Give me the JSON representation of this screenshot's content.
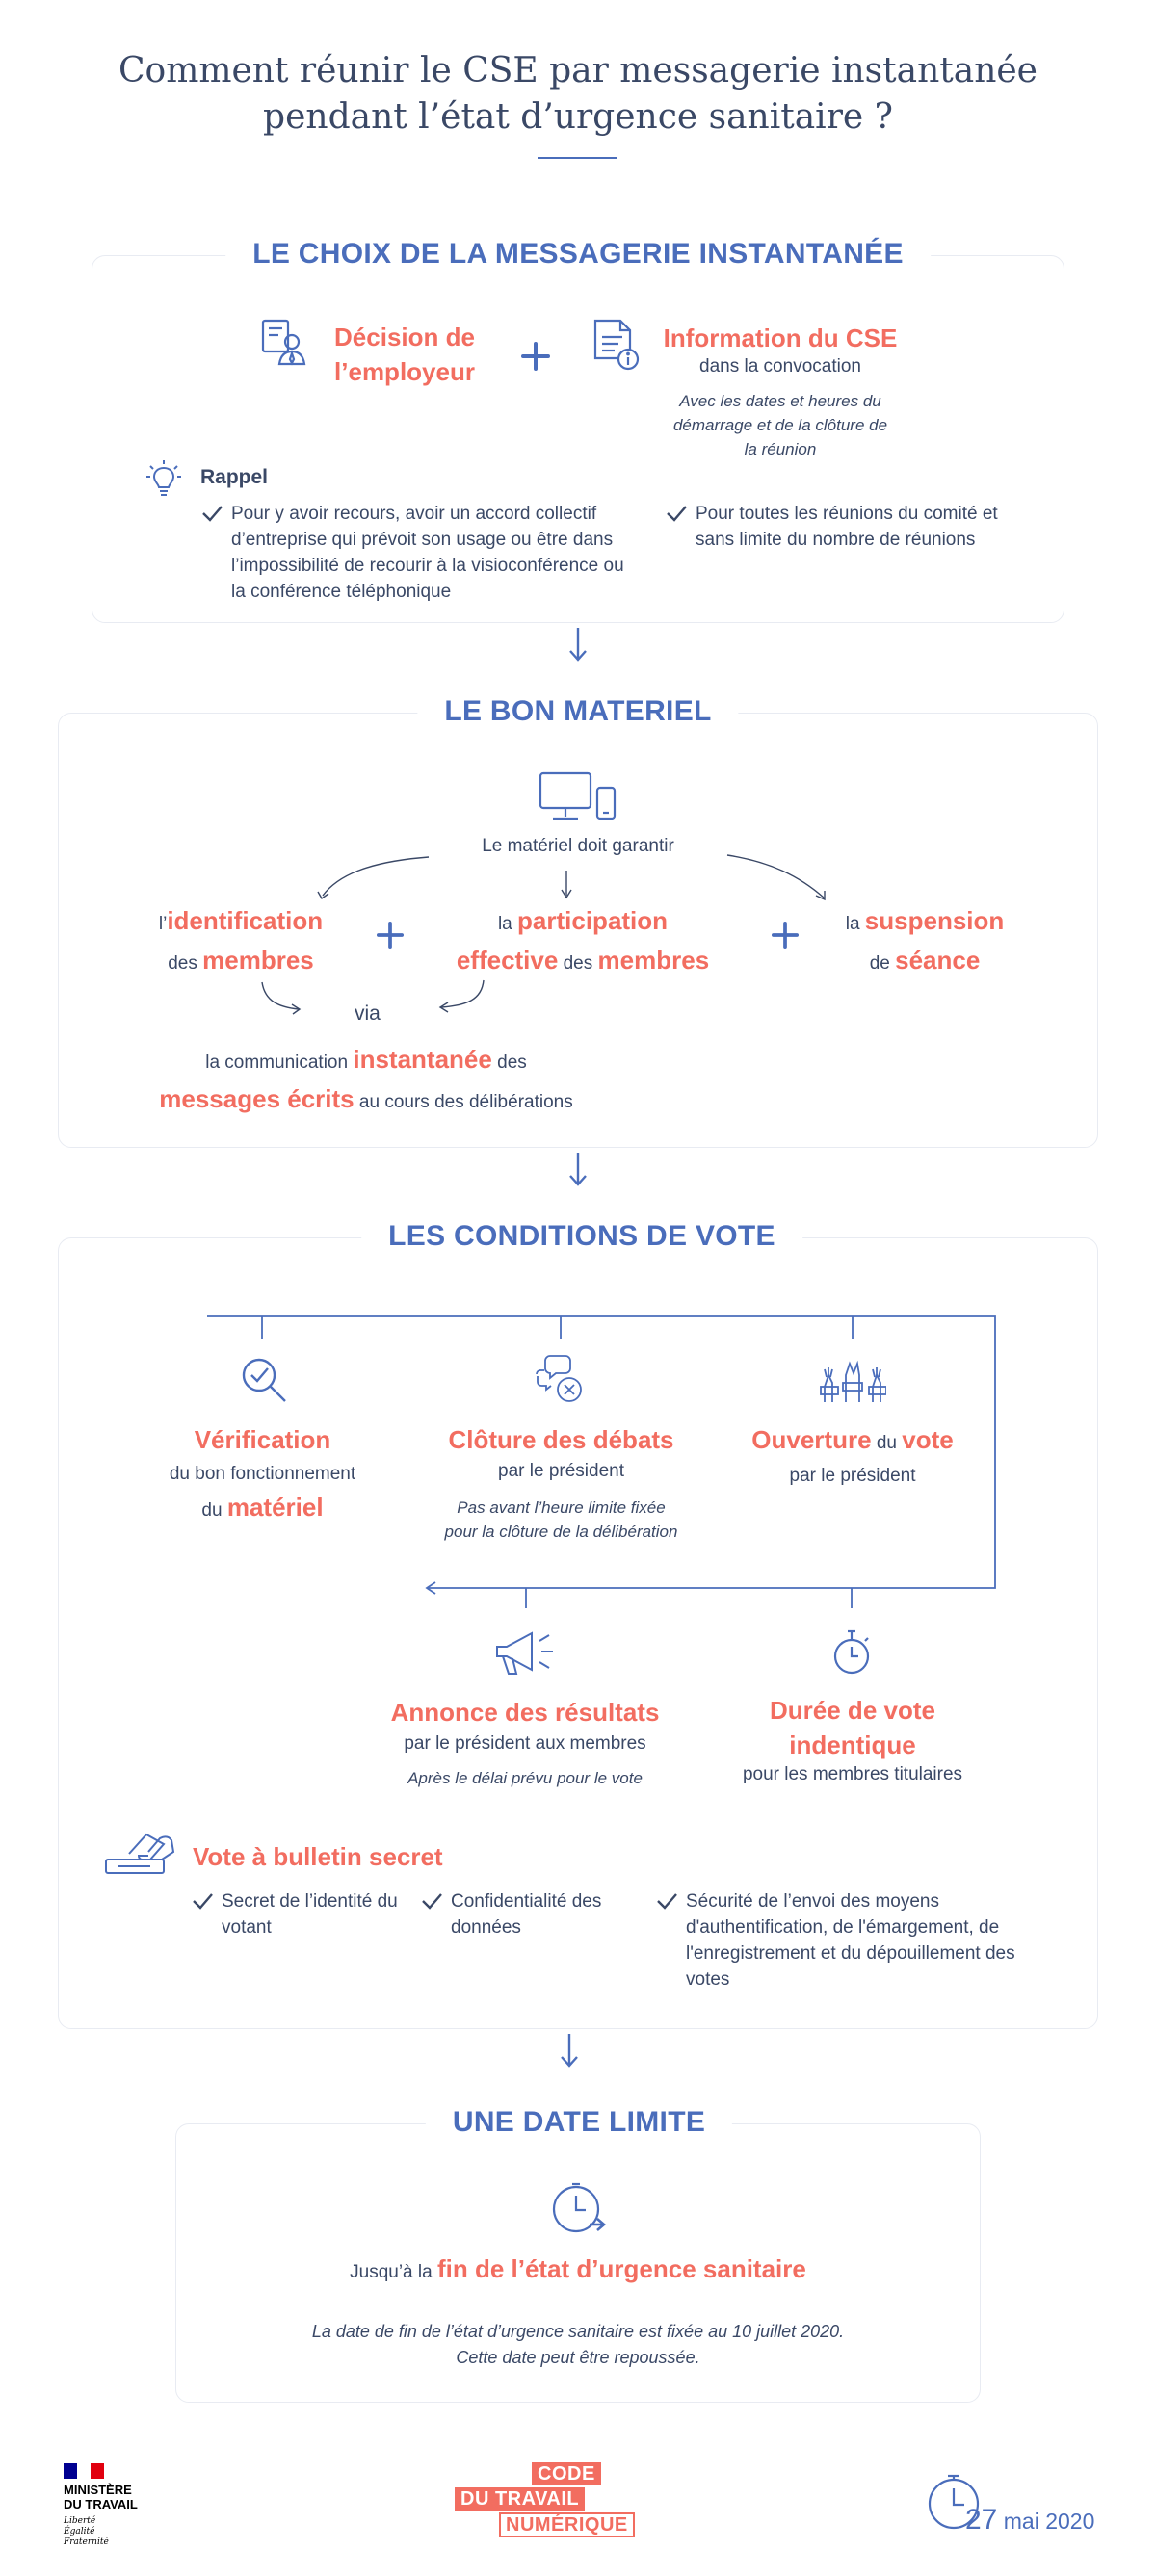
{
  "header": {
    "title_line1": "Comment réunir le CSE par messagerie instantanée",
    "title_line2": "pendant l’état d’urgence sanitaire ?"
  },
  "section1": {
    "title": "LE CHOIX DE LA MESSAGERIE INSTANTANÉE",
    "employer_line1": "Décision de",
    "employer_line2": "l’employeur",
    "info_title": "Information du CSE",
    "info_sub": "dans la convocation",
    "info_note_line1": "Avec les dates et heures du",
    "info_note_line2": "démarrage et de la clôture de",
    "info_note_line3": "la réunion",
    "rappel_label": "Rappel",
    "rappel_item1": "Pour y avoir recours, avoir un accord collectif d’entreprise qui prévoit son usage ou être dans l’impossibilité de recourir à la visioconférence ou la conférence téléphonique",
    "rappel_item2": "Pour toutes les réunions du comité et sans limite du nombre de réunions"
  },
  "section2": {
    "title": "LE BON MATERIEL",
    "guarantee": "Le matériel doit garantir",
    "c1_pre": "l’",
    "c1_hl": "identification",
    "c1_mid": "des ",
    "c1_hl2": "membres",
    "c2_pre": "la ",
    "c2_hl": "participation",
    "c2_hl2": "effective",
    "c2_mid": " des ",
    "c2_hl3": "membres",
    "c3_pre": "la ",
    "c3_hl": "suspension",
    "c3_mid": "de ",
    "c3_hl2": "séance",
    "via": "via",
    "comm_pre": "la communication ",
    "comm_hl": "instantanée",
    "comm_post": " des",
    "comm2_hl": "messages écrits",
    "comm2_post": " au cours des délibérations"
  },
  "section3": {
    "title": "LES CONDITIONS DE VOTE",
    "verif_title": "Vérification",
    "verif_sub1": "du bon fonctionnement",
    "verif_sub2_pre": "du ",
    "verif_sub2_hl": "matériel",
    "cloture_title": "Clôture des débats",
    "cloture_sub": "par le président",
    "cloture_note1": "Pas avant l’heure limite fixée",
    "cloture_note2": "pour la clôture de la délibération",
    "ouverture_hl": "Ouverture",
    "ouverture_mid": " du ",
    "ouverture_hl2": "vote",
    "ouverture_sub": "par le président",
    "annonce_title": "Annonce des résultats",
    "annonce_sub": "par le président aux membres",
    "annonce_note": "Après le délai prévu pour le vote",
    "duree_title1": "Durée de vote",
    "duree_title2": "indentique",
    "duree_sub": "pour les membres titulaires",
    "secret_title": "Vote à bulletin secret",
    "secret_item1": "Secret de l’identité du votant",
    "secret_item2": "Confidentialité des données",
    "secret_item3": "Sécurité de l’envoi des moyens d'authentification, de l'émargement, de l'enregistrement et du dépouillement des votes"
  },
  "section4": {
    "title": "UNE DATE LIMITE",
    "jusqu_pre": "Jusqu’à la ",
    "jusqu_hl": "fin de l’état d’urgence sanitaire",
    "note1": "La date de fin de l’état d’urgence sanitaire est fixée au 10 juillet 2020.",
    "note2": "Cette date peut être repoussée."
  },
  "footer": {
    "ministry_line1": "MINISTÈRE",
    "ministry_line2": "DU TRAVAIL",
    "motto1": "Liberté",
    "motto2": "Égalité",
    "motto3": "Fraternité",
    "logo_line1": "CODE",
    "logo_line2": "DU TRAVAIL",
    "logo_line3": "NUMÉRIQUE",
    "date_day": "27",
    "date_rest": " mai 2020"
  },
  "colors": {
    "accent_blue": "#4a6dbb",
    "accent_red": "#f26d60",
    "text_dark": "#3a4866"
  },
  "icons": [
    "employer-icon",
    "plus-icon",
    "document-icon",
    "lightbulb-icon",
    "check-icon",
    "down-arrow-icon",
    "computer-icon",
    "magnifier-check-icon",
    "chat-close-icon",
    "raised-hands-icon",
    "megaphone-icon",
    "stopwatch-icon",
    "ballot-hand-icon",
    "clock-arrow-icon"
  ]
}
